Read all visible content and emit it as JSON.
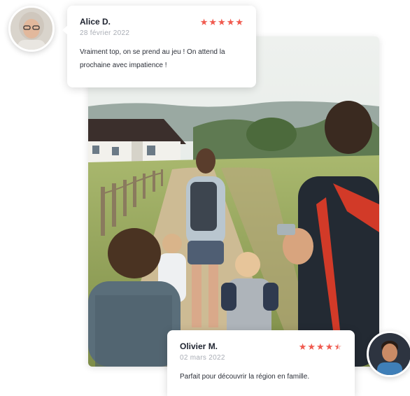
{
  "reviews": [
    {
      "name": "Alice D.",
      "date": "28 février 2022",
      "rating": 5,
      "comment": "Vraiment top, on se prend au jeu ! On attend la prochaine avec impatience !"
    },
    {
      "name": "Olivier M.",
      "date": "02 mars 2022",
      "rating": 4.5,
      "comment": "Parfait pour découvrir la région en famille."
    }
  ],
  "colors": {
    "star": "#f05a4f",
    "name": "#1f2430",
    "date": "#a9adb5",
    "card_bg": "#ffffff"
  },
  "icons": {
    "star": "star-icon",
    "half_star": "star-half-icon"
  }
}
